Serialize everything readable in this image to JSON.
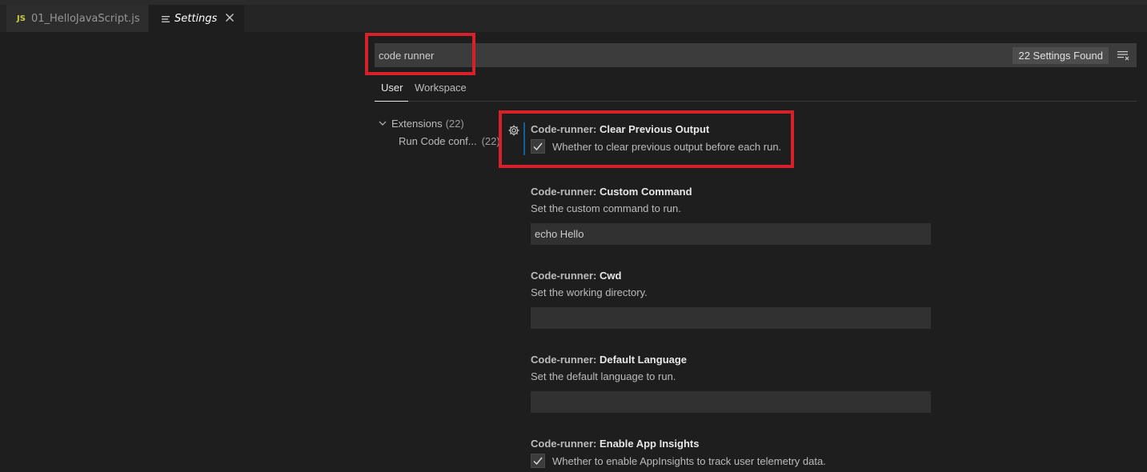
{
  "tabs": [
    {
      "badge": "JS",
      "label": "01_HelloJavaScript.js"
    },
    {
      "label": "Settings"
    }
  ],
  "search": {
    "value": "code runner",
    "results_count": "22 Settings Found"
  },
  "scopes": [
    "User",
    "Workspace"
  ],
  "toc": [
    {
      "label": "Extensions",
      "count": "(22)",
      "expanded": true
    },
    {
      "label": "Run Code conf...",
      "count": "(22)"
    }
  ],
  "settings": [
    {
      "category": "Code-runner:",
      "name": "Clear Previous Output",
      "type": "checkbox",
      "checked": true,
      "description": "Whether to clear previous output before each run."
    },
    {
      "category": "Code-runner:",
      "name": "Custom Command",
      "type": "text",
      "description": "Set the custom command to run.",
      "value": "echo Hello"
    },
    {
      "category": "Code-runner:",
      "name": "Cwd",
      "type": "text",
      "description": "Set the working directory.",
      "value": ""
    },
    {
      "category": "Code-runner:",
      "name": "Default Language",
      "type": "text",
      "description": "Set the default language to run.",
      "value": ""
    },
    {
      "category": "Code-runner:",
      "name": "Enable App Insights",
      "type": "checkbox",
      "checked": true,
      "description": "Whether to enable AppInsights to track user telemetry data."
    }
  ],
  "colors": {
    "highlight": "#d6202a",
    "background": "#1e1e1e",
    "focus_bar": "#0e639c"
  },
  "icons": [
    "js-file-icon",
    "settings-file-icon",
    "close-icon",
    "filter-icon",
    "chevron-down-icon",
    "gear-icon",
    "checkmark-icon"
  ]
}
